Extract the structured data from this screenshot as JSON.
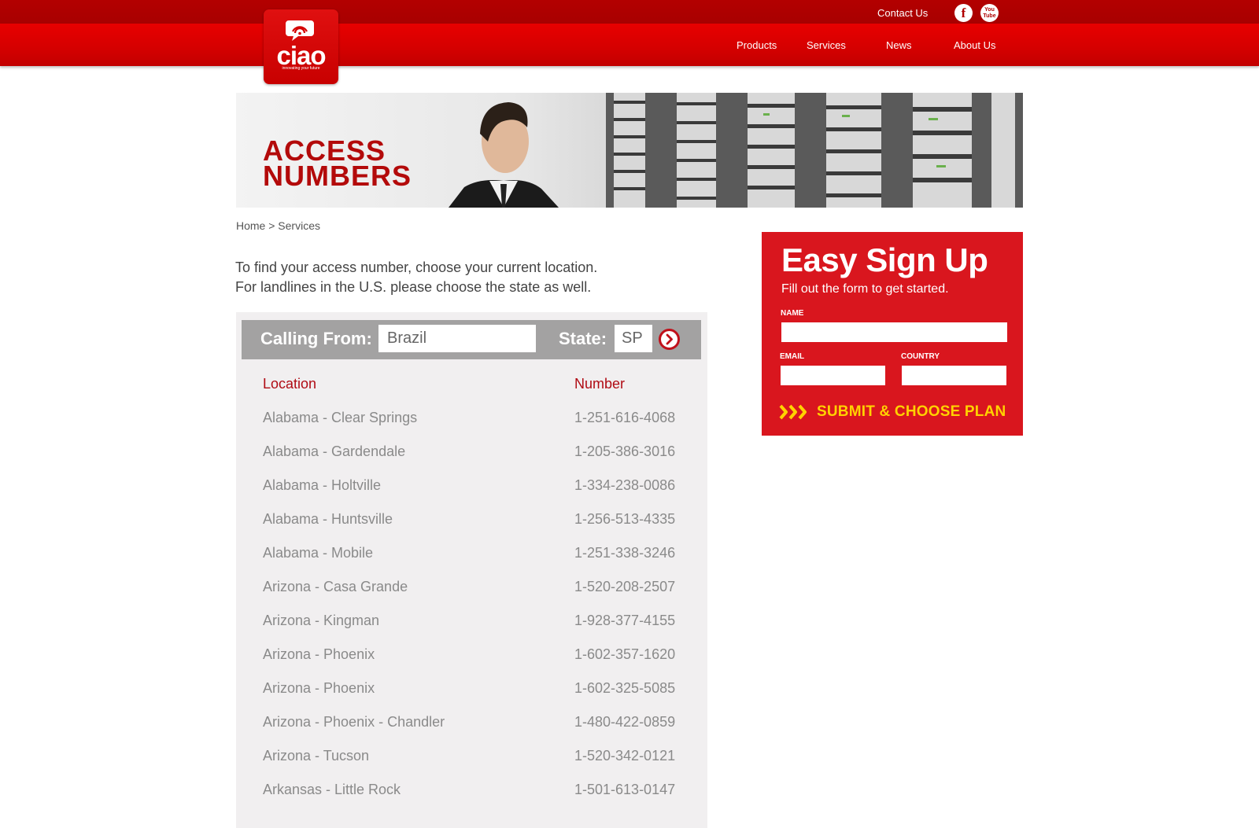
{
  "header": {
    "contact_label": "Contact Us",
    "social": {
      "facebook_glyph": "f",
      "youtube_glyph_1": "You",
      "youtube_glyph_2": "Tube"
    },
    "nav": [
      "Products",
      "Services",
      "News",
      "About Us"
    ],
    "logo": {
      "word": "ciao",
      "tagline": "innovating your future",
      "icon": "chat-bubble-wifi-icon"
    }
  },
  "banner": {
    "title_line1": "ACCESS",
    "title_line2": "NUMBERS"
  },
  "breadcrumb": "Home > Services",
  "intro": {
    "line1": "To find your access number, choose your current location.",
    "line2": "For landlines in the U.S. please choose the state as well."
  },
  "filter": {
    "calling_label": "Calling From:",
    "country_value": "Brazil",
    "state_label": "State:",
    "state_value": "SP",
    "go_icon": "chevron-right-circle-icon"
  },
  "table": {
    "headers": {
      "location": "Location",
      "number": "Number"
    },
    "rows": [
      {
        "location": "Alabama - Clear Springs",
        "number": "1-251-616-4068"
      },
      {
        "location": "Alabama - Gardendale",
        "number": "1-205-386-3016"
      },
      {
        "location": "Alabama - Holtville",
        "number": "1-334-238-0086"
      },
      {
        "location": "Alabama - Huntsville",
        "number": "1-256-513-4335"
      },
      {
        "location": "Alabama - Mobile",
        "number": "1-251-338-3246"
      },
      {
        "location": "Arizona - Casa Grande",
        "number": "1-520-208-2507"
      },
      {
        "location": "Arizona - Kingman",
        "number": "1-928-377-4155"
      },
      {
        "location": "Arizona - Phoenix",
        "number": "1-602-357-1620"
      },
      {
        "location": "Arizona - Phoenix",
        "number": "1-602-325-5085"
      },
      {
        "location": "Arizona - Phoenix - Chandler",
        "number": "1-480-422-0859"
      },
      {
        "location": "Arizona - Tucson",
        "number": "1-520-342-0121"
      },
      {
        "location": "Arkansas - Little Rock",
        "number": "1-501-613-0147"
      }
    ]
  },
  "signup": {
    "title": "Easy Sign Up",
    "subtitle": "Fill out the form to get started.",
    "name_label": "NAME",
    "email_label": "EMAIL",
    "country_label": "COUNTRY",
    "submit_label": "SUBMIT & CHOOSE PLAN",
    "submit_icon": "triple-chevron-right-icon"
  },
  "colors": {
    "brand_red": "#d9161e",
    "dark_red": "#b00000",
    "submit_yellow": "#ffd200",
    "panel_gray": "#f1eff0"
  }
}
